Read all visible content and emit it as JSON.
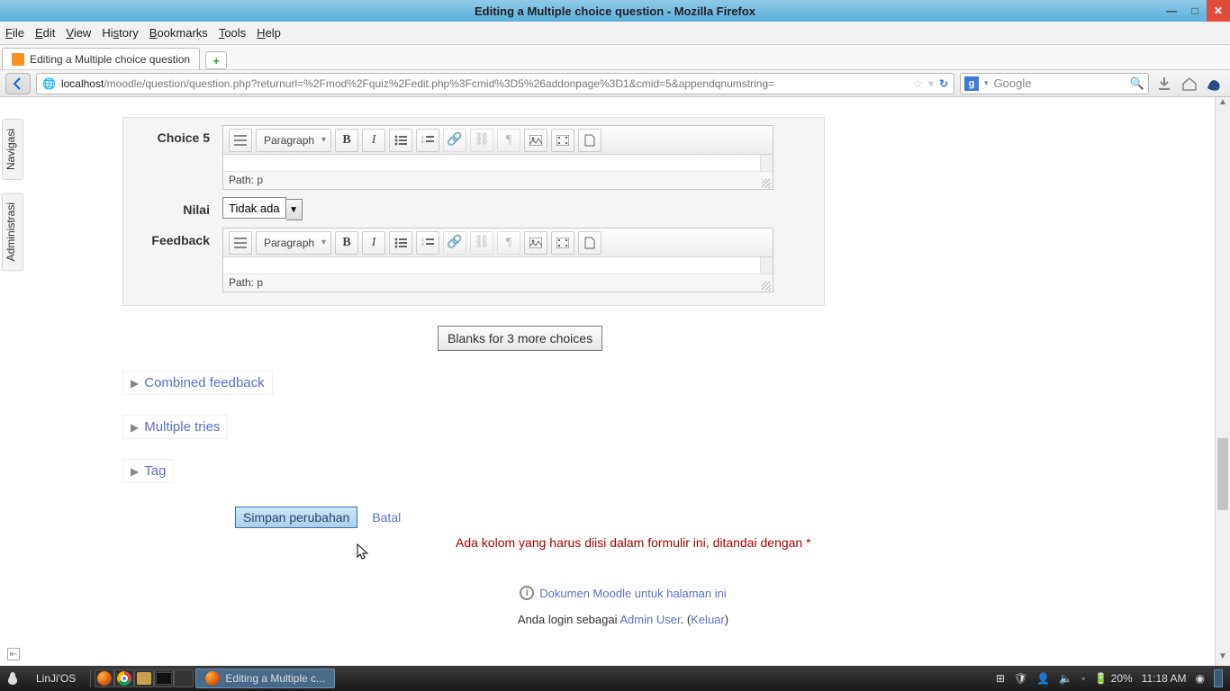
{
  "window": {
    "title": "Editing a Multiple choice question - Mozilla Firefox"
  },
  "menubar": {
    "file": "File",
    "edit": "Edit",
    "view": "View",
    "history": "History",
    "bookmarks": "Bookmarks",
    "tools": "Tools",
    "help": "Help"
  },
  "tab": {
    "title": "Editing a Multiple choice question"
  },
  "url": {
    "host": "localhost",
    "path": "/moodle/question/question.php?returnurl=%2Fmod%2Fquiz%2Fedit.php%3Fcmid%3D5%26addonpage%3D1&cmid=5&appendqnumstring="
  },
  "search": {
    "placeholder": "Google"
  },
  "sidetabs": {
    "nav": "Navigasi",
    "admin": "Administrasi"
  },
  "form": {
    "choice_label": "Choice 5",
    "nilai_label": "Nilai",
    "nilai_value": "Tidak ada",
    "feedback_label": "Feedback",
    "paragraph": "Paragraph",
    "path": "Path: p",
    "blanks_btn": "Blanks for 3 more choices"
  },
  "sections": {
    "combined": "Combined feedback",
    "multiple": "Multiple tries",
    "tag": "Tag"
  },
  "actions": {
    "save": "Simpan perubahan",
    "cancel": "Batal"
  },
  "required_msg": "Ada kolom yang harus diisi dalam formulir ini, ditandai dengan ",
  "required_ast": "*",
  "docs_link": "Dokumen Moodle untuk halaman ini",
  "login": {
    "prefix": "Anda login sebagai ",
    "user": "Admin User",
    "sep": ". (",
    "logout": "Keluar",
    "end": ")"
  },
  "taskbar": {
    "os": "LinJi'OS",
    "active": "Editing a Multiple c...",
    "battery": "20%",
    "time": "11:18 AM"
  }
}
